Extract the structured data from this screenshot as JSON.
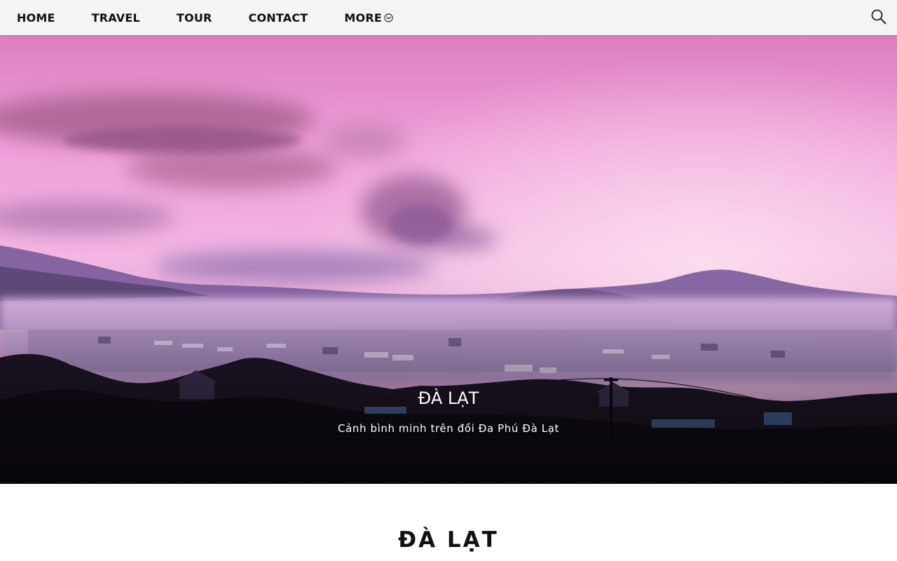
{
  "nav": {
    "items": [
      {
        "label": "HOME"
      },
      {
        "label": "TRAVEL"
      },
      {
        "label": "TOUR"
      },
      {
        "label": "CONTACT"
      },
      {
        "label": "MORE",
        "icon": "chevron-down-circle-icon"
      }
    ],
    "search_icon": "search-icon"
  },
  "hero": {
    "title": "ĐÀ LẠT",
    "subtitle": "Cảnh bình minh trên đồi Đa Phú Đà Lạt",
    "image": "misty-sunrise-over-dalat-hills"
  },
  "content": {
    "heading": "ĐÀ LẠT"
  },
  "colors": {
    "nav_bg": "#f4f4f4",
    "nav_text": "#111111",
    "sky_top": "#e27fbf",
    "sky_mid": "#f0a8de",
    "mist": "#c9a6d6",
    "foreground": "#1a1220"
  }
}
